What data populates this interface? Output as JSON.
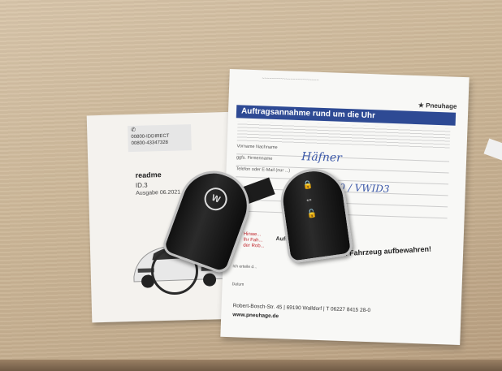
{
  "booklet": {
    "sticker_line1": "00800-IDDIRECT",
    "sticker_line2": "00800-43347328",
    "readme": "readme",
    "model": "ID.3",
    "edition": "Ausgabe 06.2021"
  },
  "envelope": {
    "brand": "★ Pneuhage",
    "title": "Auftragsannahme rund um die Uhr",
    "field_name": "Vorname Nachname",
    "field_firm": "ggfs. Firmenname",
    "field_phone": "Telefon oder E-Mail (nur ...)",
    "handwritten_name": "Häfner",
    "handwritten_plate": "I 2420 / VWID3",
    "red_note": "Hinwe...\nIhr Fah...\nder Rob...",
    "aufl": "Auftr...",
    "stamp": "Bitte immer im Fahrzeug aufbewahren!",
    "sign_label": "Ich erteile d...",
    "datum": "Datum",
    "address": "Robert-Bosch-Str. 45 | 69190 Walldorf | T 06227 8415 28-0",
    "website": "www.pneuhage.de"
  },
  "colors": {
    "title_bar": "#2e4a94",
    "handwriting": "#3a57a8",
    "table": "#cdb899"
  }
}
